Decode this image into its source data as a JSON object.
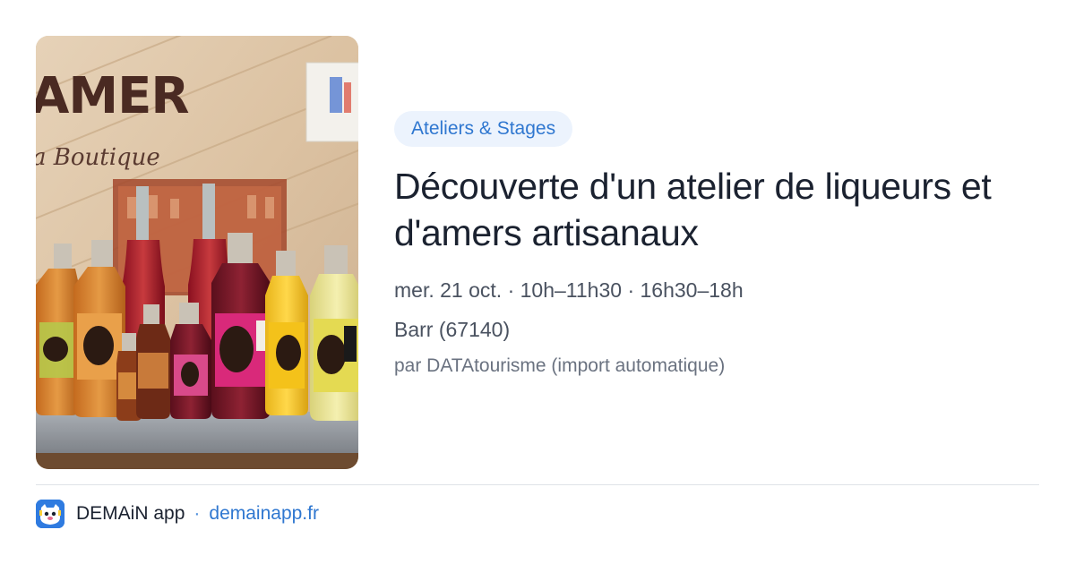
{
  "event": {
    "category": "Ateliers & Stages",
    "title": "Découverte d'un atelier de liqueurs et d'amers artisanaux",
    "date": "mer. 21 oct.",
    "time_slot_1": "10h–11h30",
    "time_slot_2": "16h30–18h",
    "separator": "·",
    "location": "Barr (67140)",
    "source": "par DATAtourisme (import automatique)",
    "image": {
      "sign_text": "AMER",
      "sign_subtext": "a Boutique"
    }
  },
  "footer": {
    "app_name": "DEMAiN app",
    "separator": "·",
    "link": "demainapp.fr"
  },
  "colors": {
    "accent": "#2f77d0",
    "pill_bg": "#ecf3fd",
    "title": "#1b2230",
    "meta": "#4a5260",
    "divider": "#dfe3e8",
    "app_icon_bg": "#2f7be0"
  },
  "icons": {
    "app": "demain-app-icon"
  }
}
